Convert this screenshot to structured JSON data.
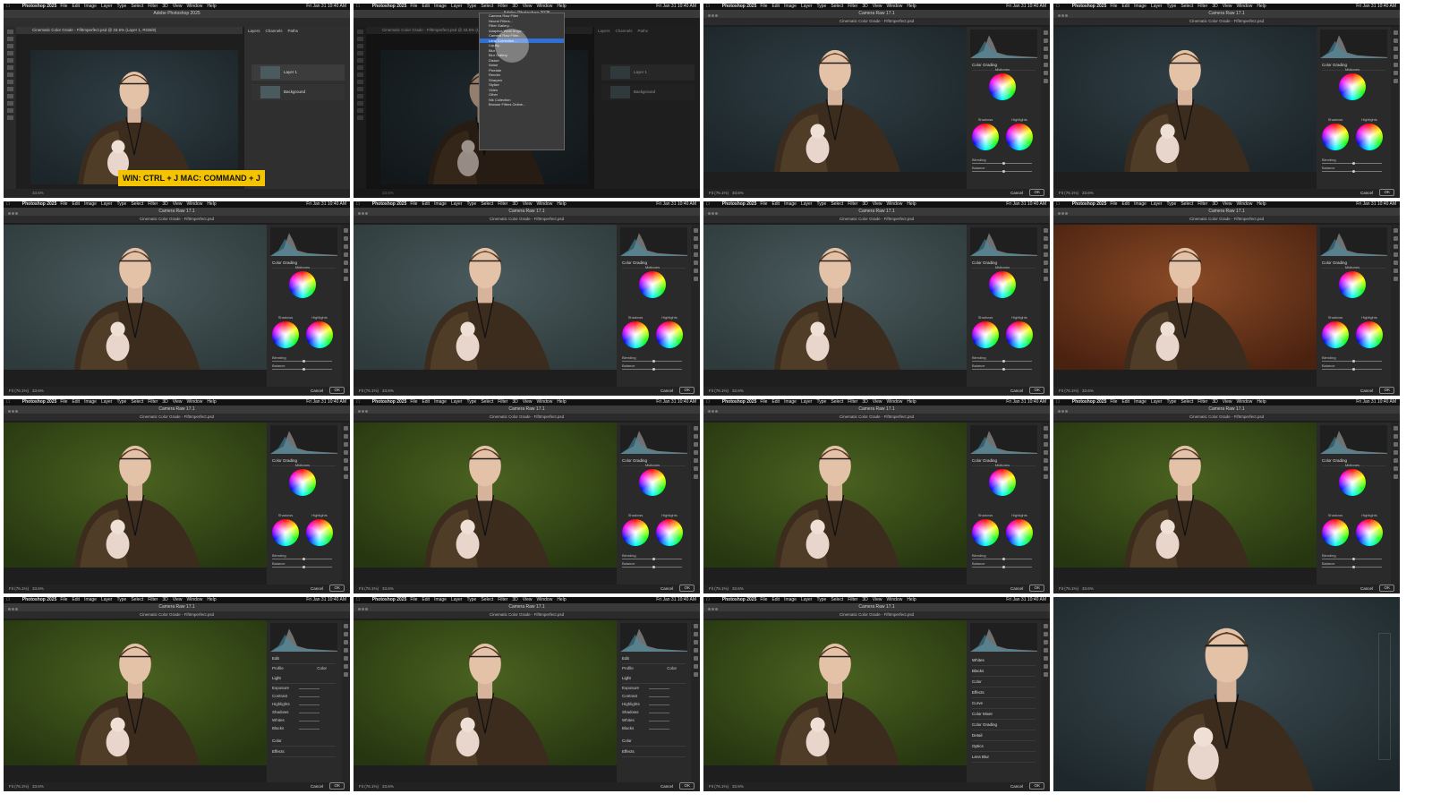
{
  "menubar": {
    "apple_icon": "apple-icon",
    "app_name": "Photoshop 2025",
    "menus": [
      "File",
      "Edit",
      "Image",
      "Layer",
      "Type",
      "Select",
      "Filter",
      "3D",
      "View",
      "Window",
      "Help"
    ],
    "clock": "Fri Jan 31 10:40 AM"
  },
  "photoshop": {
    "window_title": "Adobe Photoshop 2025",
    "doc_tab": "Cinematic Color Grade - FiftImperfect.psd @ 33.6% (Layer 1, RGB/8)",
    "layers_tab": "Layers",
    "channels_tab": "Channels",
    "paths_tab": "Paths",
    "layer1": "Layer 1",
    "background_layer": "Background",
    "status": "33.6%",
    "shortcut_overlay": "WIN: CTRL + J  MAC: COMMAND + J",
    "filter_menu": [
      "Camera Raw Filter",
      "Neural Filters...",
      "Filter Gallery...",
      "Adaptive Wide Angle...",
      "Camera Raw Filter...",
      "Lens Correction...",
      "Liquify...",
      "Blur",
      "Blur Gallery",
      "Distort",
      "Noise",
      "Pixelate",
      "Render",
      "Sharpen",
      "Stylize",
      "Video",
      "Other",
      "Nik Collection",
      "Browse Filters Online..."
    ]
  },
  "camera_raw": {
    "title": "Camera Raw 17.1",
    "doc_name": "Cinematic Color Grade - FiftImperfect.psd",
    "panel_title": "Color Grading",
    "midtones": "Midtones",
    "shadows": "Shadows",
    "highlights": "Highlights",
    "blending": "Blending",
    "balance": "Balance",
    "fit_label": "Fit (76.1%)",
    "zoom": "33.6%",
    "cancel": "Cancel",
    "ok": "OK",
    "edit_title": "Edit",
    "profile_label": "Profile",
    "profile_value": "Color",
    "light_section": "Light",
    "exposure": "Exposure",
    "contrast": "Contrast",
    "highlights_slider": "Highlights",
    "shadows_slider": "Shadows",
    "whites": "Whites",
    "blacks": "Blacks",
    "color_section": "Color",
    "effects_section": "Effects",
    "curve_section": "Curve",
    "color_mixer_section": "Color Mixer",
    "color_grading_section": "Color Grading",
    "detail_section": "Detail",
    "optics_section": "Optics",
    "lens_blur_section": "Lens Blur"
  },
  "tiles": [
    {
      "kind": "ps",
      "photo": "dark"
    },
    {
      "kind": "ps-menu",
      "photo": "dark"
    },
    {
      "kind": "cr-grade",
      "photo": "dark-small",
      "layout": "compact"
    },
    {
      "kind": "cr-grade",
      "photo": "dark-small",
      "layout": "compact"
    },
    {
      "kind": "cr-grade",
      "photo": "teal"
    },
    {
      "kind": "cr-grade",
      "photo": "teal"
    },
    {
      "kind": "cr-grade",
      "photo": "teal"
    },
    {
      "kind": "cr-grade",
      "photo": "orange"
    },
    {
      "kind": "cr-grade",
      "photo": "green"
    },
    {
      "kind": "cr-grade",
      "photo": "green"
    },
    {
      "kind": "cr-grade",
      "photo": "green"
    },
    {
      "kind": "cr-grade",
      "photo": "green"
    },
    {
      "kind": "cr-edit",
      "photo": "green"
    },
    {
      "kind": "cr-edit",
      "photo": "green"
    },
    {
      "kind": "cr-sections",
      "photo": "green"
    },
    {
      "kind": "final",
      "photo": "final"
    }
  ],
  "colors": {
    "teal_bg": "#3a4a4c",
    "orange_bg": "#7a3c1c",
    "green_bg": "#3c5418",
    "dark_bg": "#28343a",
    "shortcut_yellow": "#f5c400",
    "highlight_blue": "#2f6fd6"
  }
}
